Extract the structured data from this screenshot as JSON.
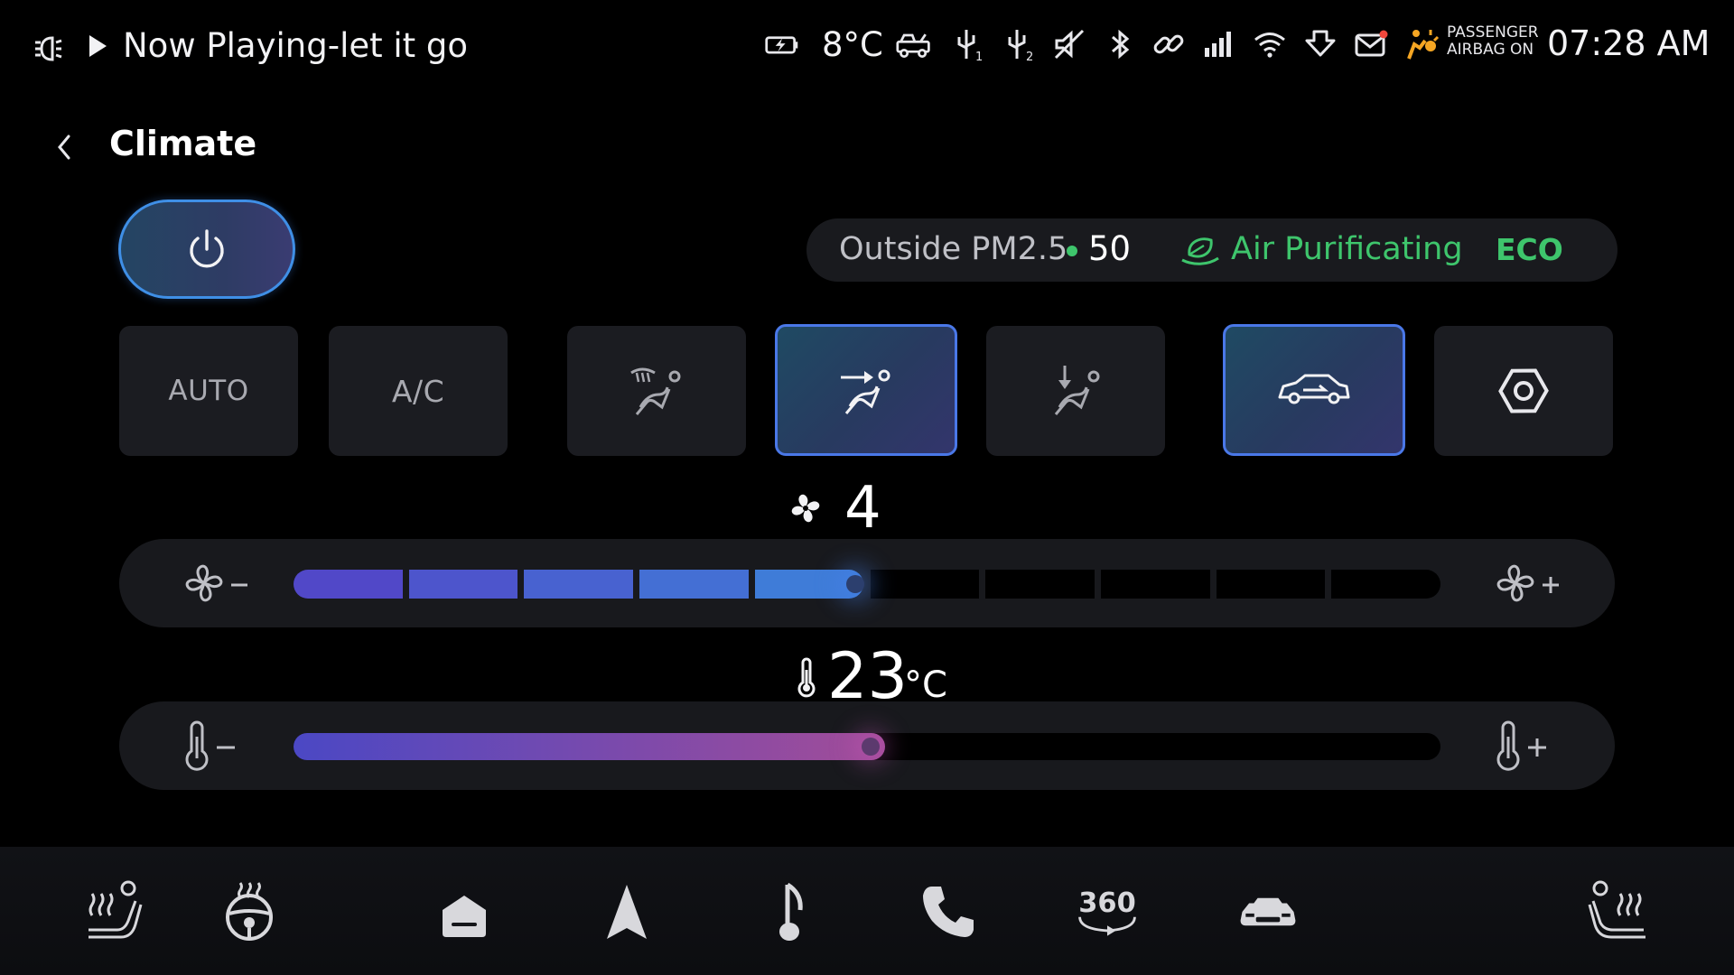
{
  "status_bar": {
    "now_playing": "Now Playing-let it go",
    "outside_temp": "8°C",
    "usb1_sub": "1",
    "usb2_sub": "2",
    "airbag_line1": "PASSENGER",
    "airbag_line2": "AIRBAG ON",
    "time": "07:28 AM",
    "icons": [
      "headlight-icon",
      "play-icon",
      "battery-charging-icon",
      "tow-truck-icon",
      "usb-icon",
      "usb-icon",
      "mute-icon",
      "bluetooth-icon",
      "link-icon",
      "signal-icon",
      "wifi-icon",
      "download-icon",
      "mail-icon",
      "airbag-icon"
    ]
  },
  "header": {
    "title": "Climate"
  },
  "air_quality": {
    "label": "Outside PM2.5",
    "value": "50",
    "purify_label": "Air Purificating",
    "mode": "ECO",
    "status_color": "#3ec56c"
  },
  "modes": {
    "auto": "AUTO",
    "ac": "A/C",
    "defrost_face_active": false,
    "face_active": true,
    "feet_active": false,
    "recirculation_active": true
  },
  "fan": {
    "level": "4",
    "level_value": 4,
    "max_level": 10
  },
  "temperature": {
    "value": "23",
    "unit": "°C",
    "fill_fraction": 0.5
  },
  "colors": {
    "accent_blue": "#4a78e8",
    "fan_fill_start": "#5148c8",
    "fan_fill_end": "#3f7cd8",
    "temp_fill_start": "#4b48c4",
    "temp_fill_end": "#a24c98",
    "eco_green": "#3ec56c"
  },
  "dock": {
    "items": [
      "seat-heat-left-icon",
      "steering-heat-icon",
      "home-icon",
      "navigation-icon",
      "music-icon",
      "phone-icon",
      "camera-360-icon",
      "car-icon",
      "seat-heat-right-icon"
    ],
    "camera_label": "360"
  }
}
